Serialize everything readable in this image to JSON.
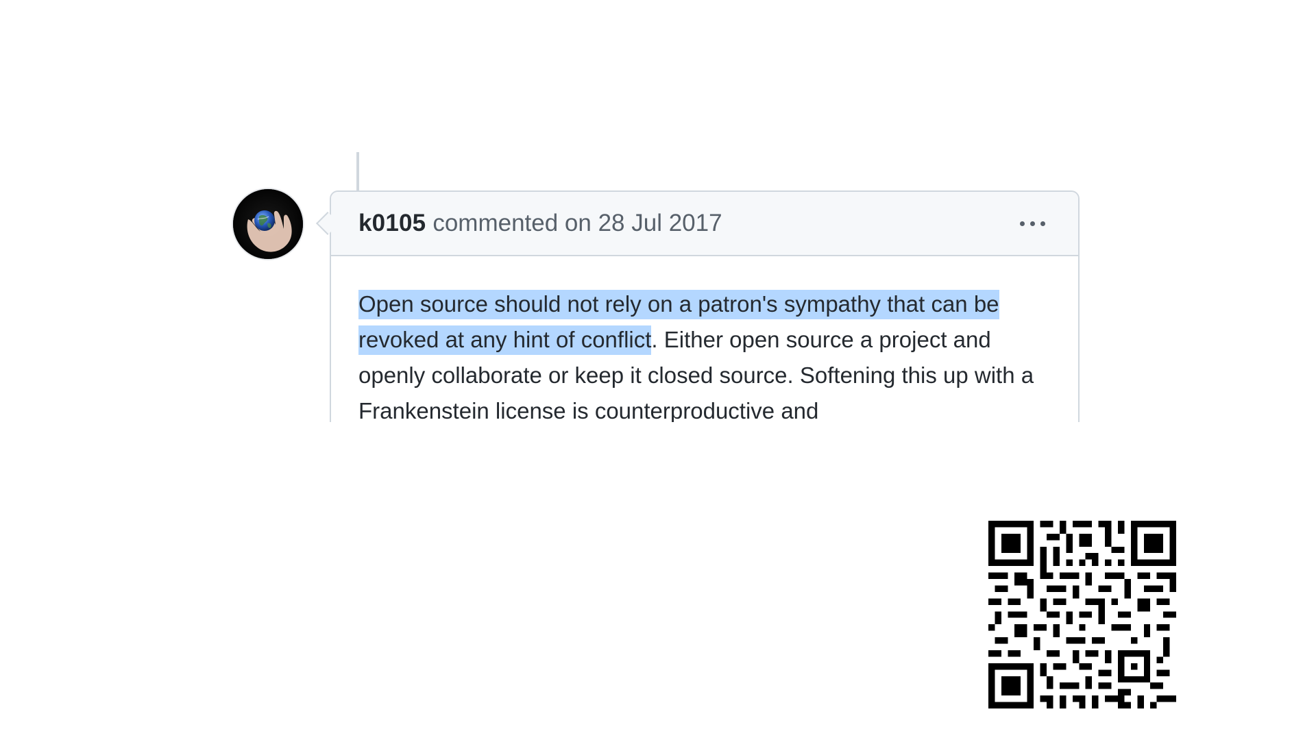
{
  "comment": {
    "author": "k0105",
    "meta": "commented on 28 Jul 2017",
    "body_highlighted": "Open source should not rely on a patron's sympathy that can be revoked at any hint of conflict",
    "body_rest": ". Either open source a project and openly collaborate or keep it closed source. Softening this up with a Frankenstein license is counterproductive and"
  },
  "icons": {
    "more": "kebab-horizontal-icon",
    "avatar": "earth-in-hand-avatar",
    "qr": "qr-code"
  },
  "colors": {
    "highlight": "#b4d7ff",
    "border": "#d0d7de",
    "header_bg": "#f6f8fa",
    "text": "#24292f",
    "muted": "#57606a"
  }
}
